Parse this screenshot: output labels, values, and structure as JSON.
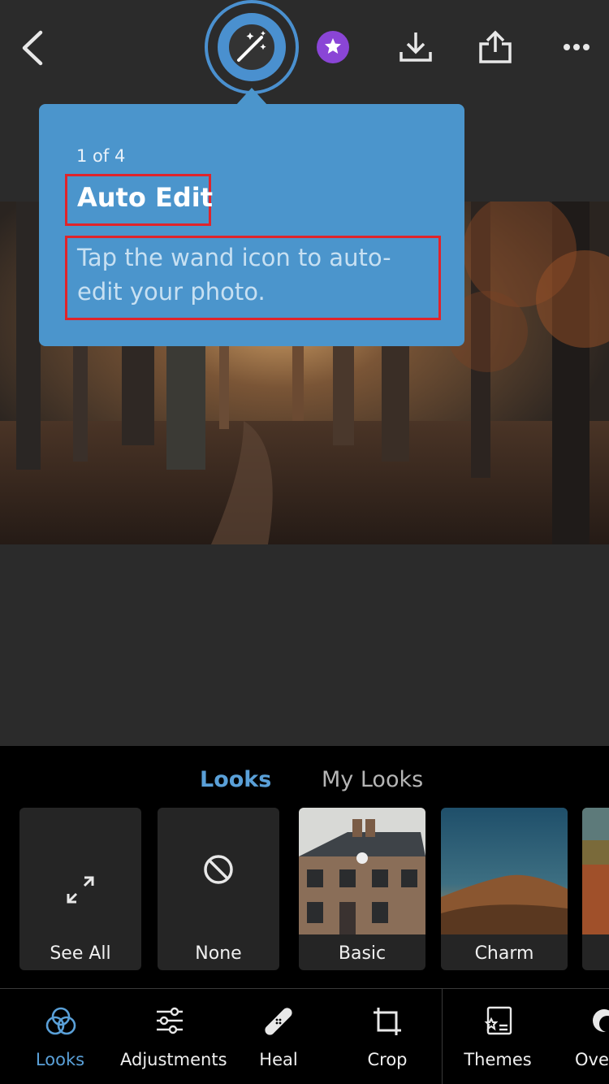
{
  "tooltip": {
    "step": "1 of 4",
    "title": "Auto Edit",
    "body": "Tap the wand icon to auto-edit your photo."
  },
  "looks_panel": {
    "tabs": [
      {
        "label": "Looks",
        "active": true
      },
      {
        "label": "My Looks",
        "active": false
      }
    ],
    "cards": [
      {
        "label": "See All",
        "icon": "expand-icon"
      },
      {
        "label": "None",
        "icon": "prohibit-icon"
      },
      {
        "label": "Basic",
        "thumb": "house-photo"
      },
      {
        "label": "Charm",
        "thumb": "hill-photo"
      }
    ]
  },
  "nav": {
    "items": [
      {
        "label": "Looks",
        "icon": "looks-icon",
        "active": true
      },
      {
        "label": "Adjustments",
        "icon": "sliders-icon"
      },
      {
        "label": "Heal",
        "icon": "bandage-icon"
      },
      {
        "label": "Crop",
        "icon": "crop-icon"
      },
      {
        "label": "Themes",
        "icon": "themes-icon"
      },
      {
        "label": "Over",
        "icon": "overlay-icon"
      }
    ]
  },
  "colors": {
    "accent": "#4a90cf",
    "tooltip_bg": "#4b95cc",
    "highlight": "#e0242b",
    "premium": "#8a45d6"
  }
}
